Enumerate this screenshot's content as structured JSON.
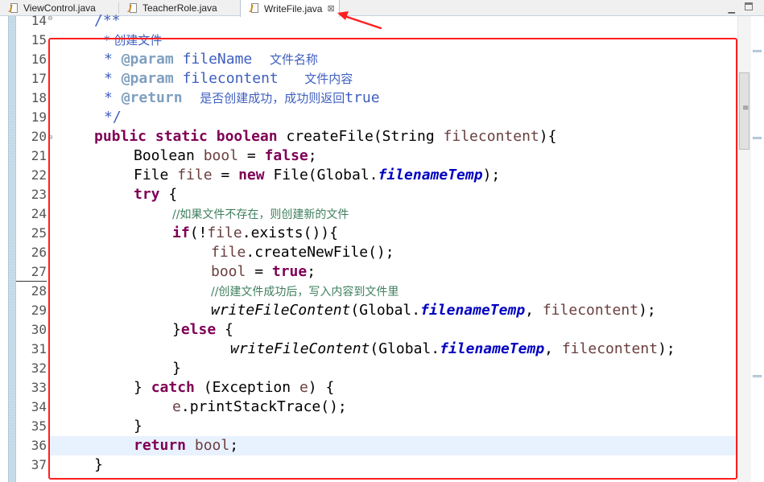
{
  "tabs": [
    {
      "label": "ViewControl.java",
      "active": false
    },
    {
      "label": "TeacherRole.java",
      "active": false
    },
    {
      "label": "WriteFile.java",
      "active": true,
      "close": "⊠"
    }
  ],
  "colors": {
    "keyword": "#7f0055",
    "variable": "#6a3e3e",
    "static_field": "#0000c0",
    "comment": "#3f7f5f",
    "javadoc": "#3f5fbf",
    "javadoc_tag": "#7f9fbf",
    "current_line": "#e8f2fe",
    "annotation_red": "#ff1f1f"
  },
  "editor": {
    "current_line": 36,
    "lines": [
      {
        "n": "14",
        "t": "/**"
      },
      {
        "n": "15",
        "t": "* 创建文件"
      },
      {
        "n": "16",
        "tag": "@param",
        "name": "fileName",
        "desc": "文件名称"
      },
      {
        "n": "17",
        "tag": "@param",
        "name": "filecontent",
        "desc": "文件内容"
      },
      {
        "n": "18",
        "tag": "@return",
        "desc": "是否创建成功，成功则返回",
        "kw": "true"
      },
      {
        "n": "19",
        "t": "*/"
      },
      {
        "n": "20",
        "kw1": "public",
        "kw2": "static",
        "kw3": "boolean",
        "method": "createFile",
        "type": "String",
        "param": "filecontent"
      },
      {
        "n": "21",
        "type": "Boolean",
        "var": "bool",
        "kw": "false"
      },
      {
        "n": "22",
        "type": "File",
        "var": "file",
        "kw": "new",
        "ctor": "File",
        "cls": "Global",
        "field": "filenameTemp"
      },
      {
        "n": "23",
        "kw": "try"
      },
      {
        "n": "24",
        "comment": "//如果文件不存在，则创建新的文件"
      },
      {
        "n": "25",
        "kw": "if",
        "var": "file",
        "call": "exists"
      },
      {
        "n": "26",
        "var": "file",
        "call": "createNewFile"
      },
      {
        "n": "27",
        "var": "bool",
        "kw": "true"
      },
      {
        "n": "28",
        "comment": "//创建文件成功后，写入内容到文件里"
      },
      {
        "n": "29",
        "call": "writeFileContent",
        "cls": "Global",
        "field": "filenameTemp",
        "var": "filecontent"
      },
      {
        "n": "30",
        "kw": "else"
      },
      {
        "n": "31",
        "call": "writeFileContent",
        "cls": "Global",
        "field": "filenameTemp",
        "var": "filecontent"
      },
      {
        "n": "32",
        "t": "}"
      },
      {
        "n": "33",
        "kw": "catch",
        "type": "Exception",
        "var": "e"
      },
      {
        "n": "34",
        "var": "e",
        "call": "printStackTrace"
      },
      {
        "n": "35",
        "t": "}"
      },
      {
        "n": "36",
        "kw": "return",
        "var": "bool"
      },
      {
        "n": "37",
        "t": "}"
      }
    ]
  }
}
